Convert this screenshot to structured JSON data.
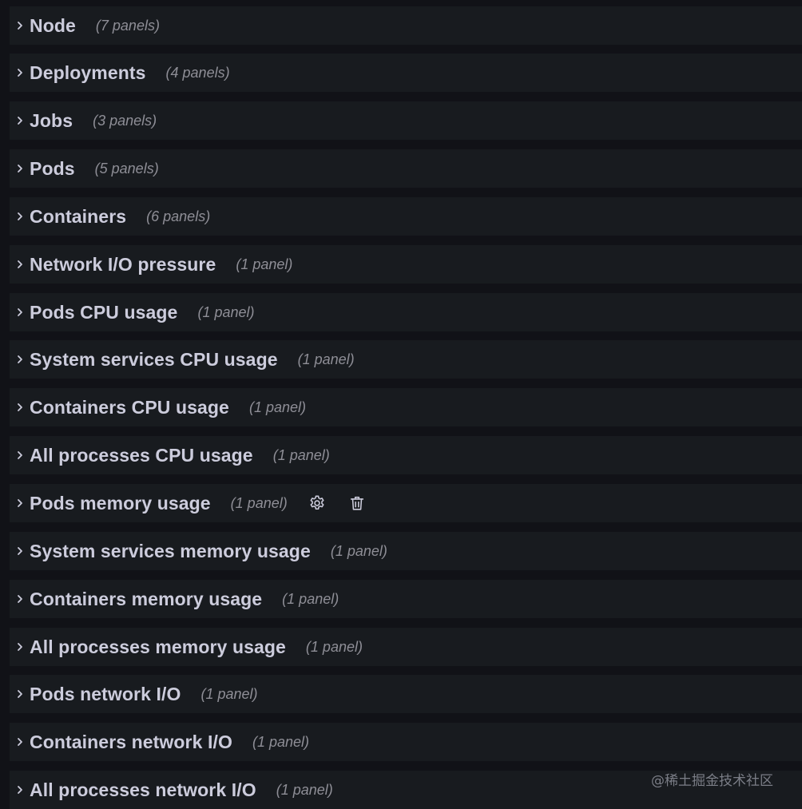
{
  "rows": [
    {
      "title": "Node",
      "count": "(7 panels)"
    },
    {
      "title": "Deployments",
      "count": "(4 panels)"
    },
    {
      "title": "Jobs",
      "count": "(3 panels)"
    },
    {
      "title": "Pods",
      "count": "(5 panels)"
    },
    {
      "title": "Containers",
      "count": "(6 panels)"
    },
    {
      "title": "Network I/O pressure",
      "count": "(1 panel)"
    },
    {
      "title": "Pods CPU usage",
      "count": "(1 panel)"
    },
    {
      "title": "System services CPU usage",
      "count": "(1 panel)"
    },
    {
      "title": "Containers CPU usage",
      "count": "(1 panel)"
    },
    {
      "title": "All processes CPU usage",
      "count": "(1 panel)"
    },
    {
      "title": "Pods memory usage",
      "count": "(1 panel)",
      "hovered": true,
      "action_icons": [
        "gear-icon",
        "trash-icon"
      ]
    },
    {
      "title": "System services memory usage",
      "count": "(1 panel)"
    },
    {
      "title": "Containers memory usage",
      "count": "(1 panel)"
    },
    {
      "title": "All processes memory usage",
      "count": "(1 panel)"
    },
    {
      "title": "Pods network I/O",
      "count": "(1 panel)"
    },
    {
      "title": "Containers network I/O",
      "count": "(1 panel)"
    },
    {
      "title": "All processes network I/O",
      "count": "(1 panel)"
    }
  ],
  "row_icon": "chevron-right-icon",
  "watermark": "@稀土掘金技术社区",
  "colors": {
    "page_background": "#111217",
    "row_background": "#181b1f",
    "title_text": "#ccccdc",
    "count_text": "#8e8e96",
    "icon": "#ccccdc"
  }
}
